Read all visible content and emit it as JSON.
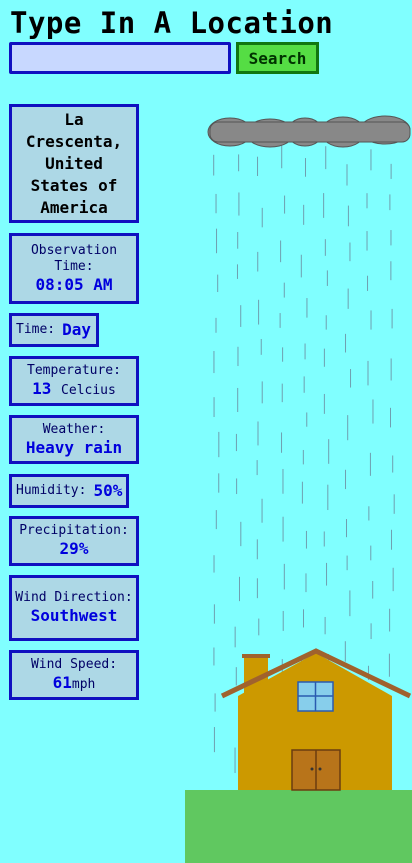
{
  "header": {
    "title": "Type In A Location"
  },
  "search": {
    "placeholder": "",
    "value": "",
    "button_label": "Search"
  },
  "location": {
    "name": "La Crescenta, United States of America"
  },
  "observation": {
    "label": "Observation Time:",
    "value": "08:05 AM"
  },
  "time_of_day": {
    "label": "Time:",
    "value": "Day"
  },
  "temperature": {
    "label": "Temperature:",
    "value": "13",
    "unit": "Celcius"
  },
  "weather": {
    "label": "Weather:",
    "value": "Heavy rain"
  },
  "humidity": {
    "label": "Humidity:",
    "value": "50%"
  },
  "precipitation": {
    "label": "Precipitation:",
    "value": "29%"
  },
  "wind_direction": {
    "label": "Wind Direction:",
    "value": "Southwest"
  },
  "wind_speed": {
    "label": "Wind Speed:",
    "value": "61",
    "unit": "mph"
  },
  "illustration": {
    "weather_icon": "rain-cloud-icon",
    "house_icon": "house-icon",
    "colors": {
      "background": "#80ffff",
      "cloud": "#888888",
      "rain": "#6f9fb0",
      "house": "#cc9900",
      "roof": "#a0622d",
      "ground": "#60c860"
    }
  }
}
